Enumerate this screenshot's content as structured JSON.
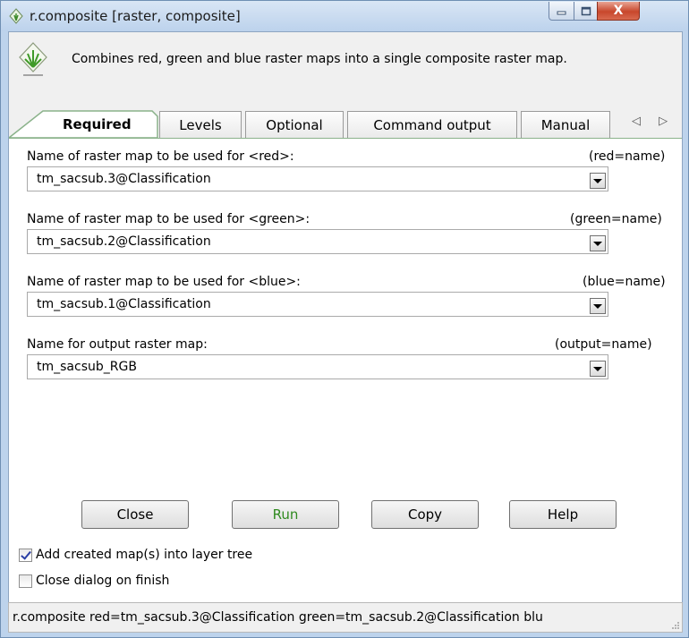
{
  "window": {
    "title": "r.composite [raster, composite]",
    "close_glyph": "X"
  },
  "description": "Combines red, green and blue raster maps into a single composite raster map.",
  "tabs": [
    {
      "label": "Required",
      "active": true
    },
    {
      "label": "Levels"
    },
    {
      "label": "Optional"
    },
    {
      "label": "Command output"
    },
    {
      "label": "Manual"
    }
  ],
  "tab_scroll": "◁ ▷",
  "fields": [
    {
      "label": "Name of raster map to be used for <red>:",
      "key": "(red=name)",
      "value": "tm_sacsub.3@Classification"
    },
    {
      "label": "Name of raster map to be used for <green>:",
      "key": "(green=name)",
      "value": "tm_sacsub.2@Classification"
    },
    {
      "label": "Name of raster map to be used for <blue>:",
      "key": "(blue=name)",
      "value": "tm_sacsub.1@Classification"
    },
    {
      "label": "Name for output raster map:",
      "key": "(output=name)",
      "value": "tm_sacsub_RGB"
    }
  ],
  "buttons": {
    "close": "Close",
    "run": "Run",
    "copy": "Copy",
    "help": "Help"
  },
  "options": {
    "add_to_tree": {
      "label": "Add created map(s) into layer tree",
      "checked": true
    },
    "close_on_finish": {
      "label": "Close dialog on finish",
      "checked": false
    }
  },
  "status": "r.composite red=tm_sacsub.3@Classification green=tm_sacsub.2@Classification blu",
  "colors": {
    "run_text": "#2f8a1f",
    "tab_accent": "#8ab28a",
    "close_red": "#c8472c"
  }
}
